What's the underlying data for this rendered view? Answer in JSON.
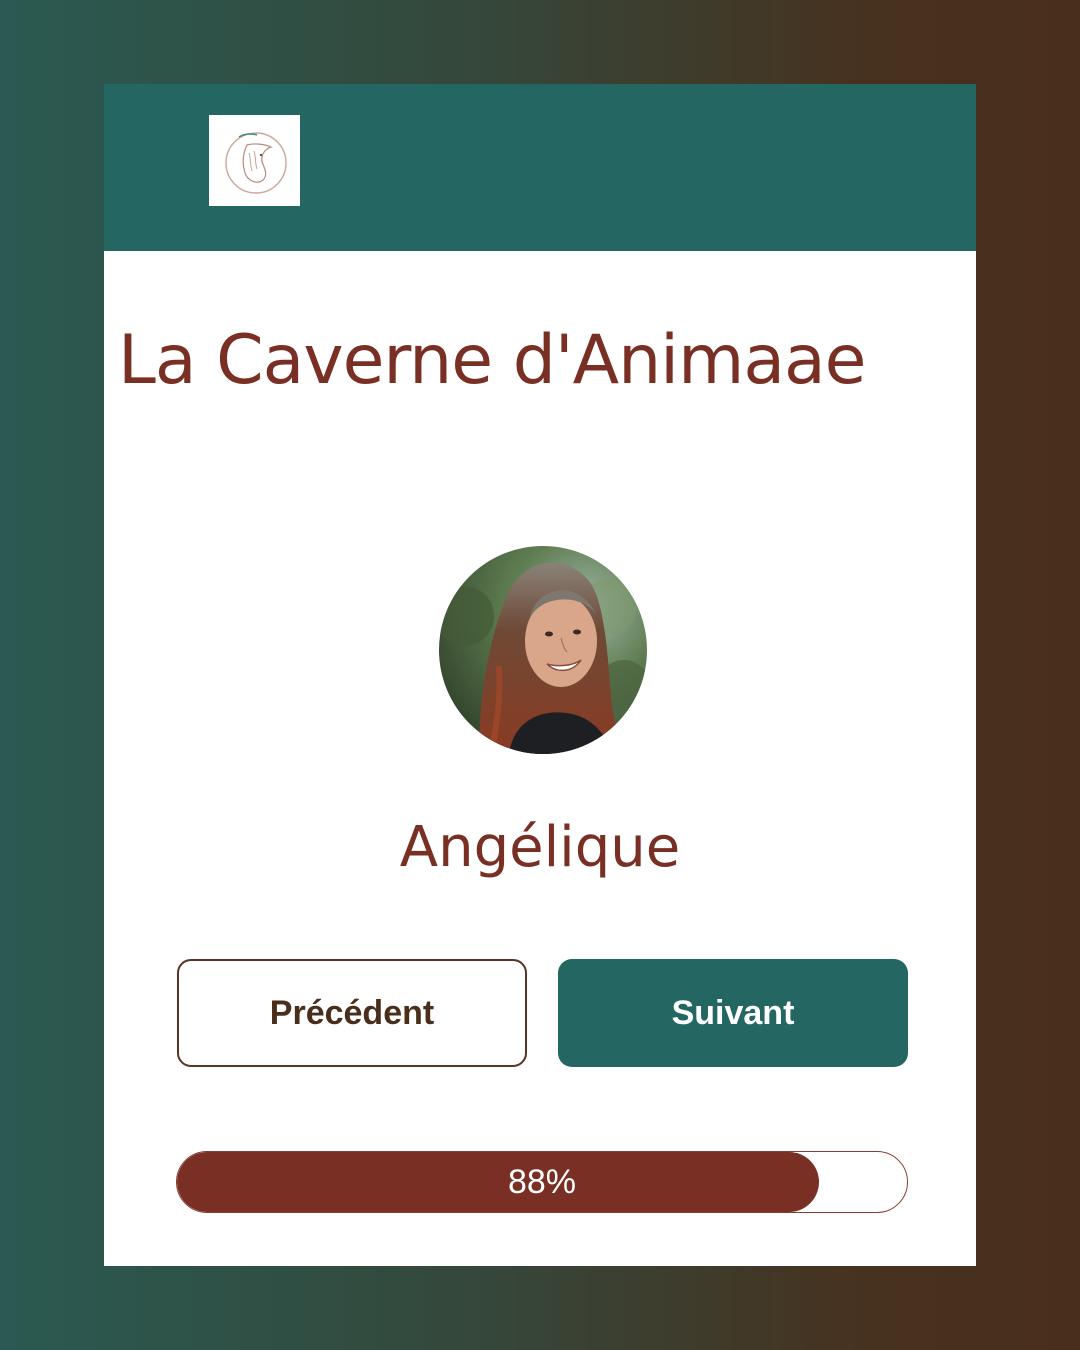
{
  "header": {
    "logo_icon": "horse-head-logo-icon",
    "background_color": "#246661"
  },
  "title": "La Caverne d'Animaae",
  "profile": {
    "avatar_icon": "woman-portrait-photo",
    "name": "Angélique"
  },
  "buttons": {
    "previous_label": "Précédent",
    "next_label": "Suivant"
  },
  "progress": {
    "label": "88%",
    "fraction": 0.88
  },
  "colors": {
    "accent_teal": "#246661",
    "accent_brown": "#7a2f24",
    "page_background_left": "#2a5a52",
    "page_background_right": "#4a2e1c"
  }
}
